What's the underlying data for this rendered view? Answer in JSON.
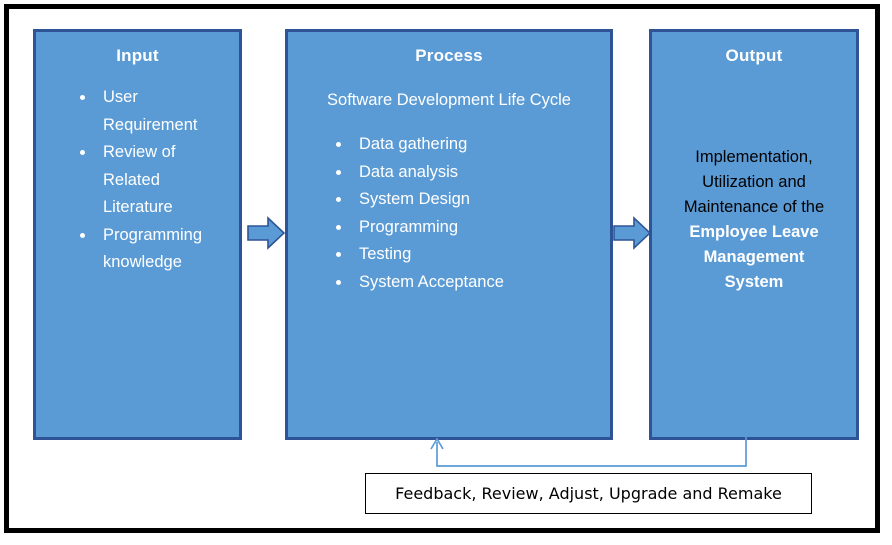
{
  "diagram": {
    "type": "ipo-conceptual-framework",
    "colors": {
      "box_fill": "#5B9BD5",
      "box_border": "#2E5496",
      "arrow_fill": "#5B9BD5",
      "arrow_border": "#2E5496",
      "connector_line": "#5B9BD5",
      "frame": "#000000",
      "text_white": "#FFFFFF",
      "text_black": "#000000"
    }
  },
  "input": {
    "title": "Input",
    "items": [
      "User Requirement",
      "Review of Related Literature",
      "Programming knowledge"
    ]
  },
  "process": {
    "title": "Process",
    "subtitle": "Software Development Life Cycle",
    "items": [
      "Data gathering",
      "Data analysis",
      "System Design",
      "Programming",
      "Testing",
      "System Acceptance"
    ]
  },
  "output": {
    "title": "Output",
    "lines_plain": [
      "Implementation,",
      "Utilization and",
      "Maintenance of the"
    ],
    "lines_emphasized": [
      "Employee Leave",
      "Management",
      "System"
    ]
  },
  "feedback": {
    "label": "Feedback, Review, Adjust, Upgrade and Remake"
  },
  "arrows": {
    "input_to_process": "block-arrow-right",
    "process_to_output": "block-arrow-right",
    "output_to_process": "feedback-loop-arrow"
  }
}
